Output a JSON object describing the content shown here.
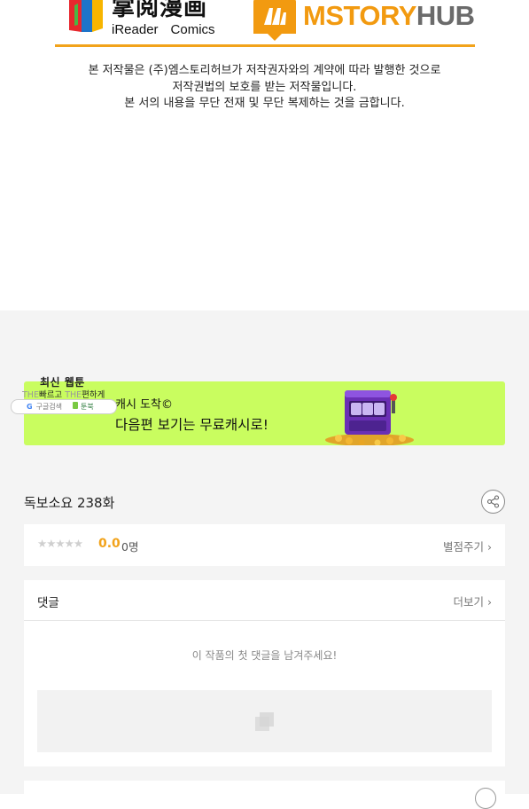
{
  "logos": {
    "ireader_cn": "掌阅漫画",
    "ireader_en": "iReader",
    "ireader_comics": "Comics",
    "mstory_ms": "MSTORY",
    "mstory_hub": "HUB"
  },
  "copyright": {
    "line1": "본 저작물은 (주)엠스토리허브가 저작권자와의 계약에 따라 발행한 것으로",
    "line2": "저작권법의 보호를 받는 저작물입니다.",
    "line3": "본 서의 내용을 무단 전재 및 무단 복제하는 것을 금합니다."
  },
  "promo": {
    "title": "최신 웹툰",
    "the1": "THE",
    "fast": "빠르고",
    "the2": "THE",
    "easy": "편하게",
    "google": "G",
    "google_label": "구글검색",
    "toonbook": "툰북"
  },
  "banner": {
    "line1": "캐시 도착©",
    "line2": "다음편 보기는 무료캐시로!"
  },
  "episode": {
    "title": "독보소요 238화"
  },
  "rating": {
    "stars": "★★★★★",
    "score": "0.0",
    "count": "0명",
    "rate_link": "별점주기 ›"
  },
  "comments": {
    "title": "댓글",
    "more": "더보기 ›",
    "empty": "이 작품의 첫 댓글을 남겨주세요!"
  },
  "colors": {
    "accent_orange": "#f2a31b",
    "banner_green": "#c9fd5f",
    "page_grey": "#f4f4f4"
  }
}
